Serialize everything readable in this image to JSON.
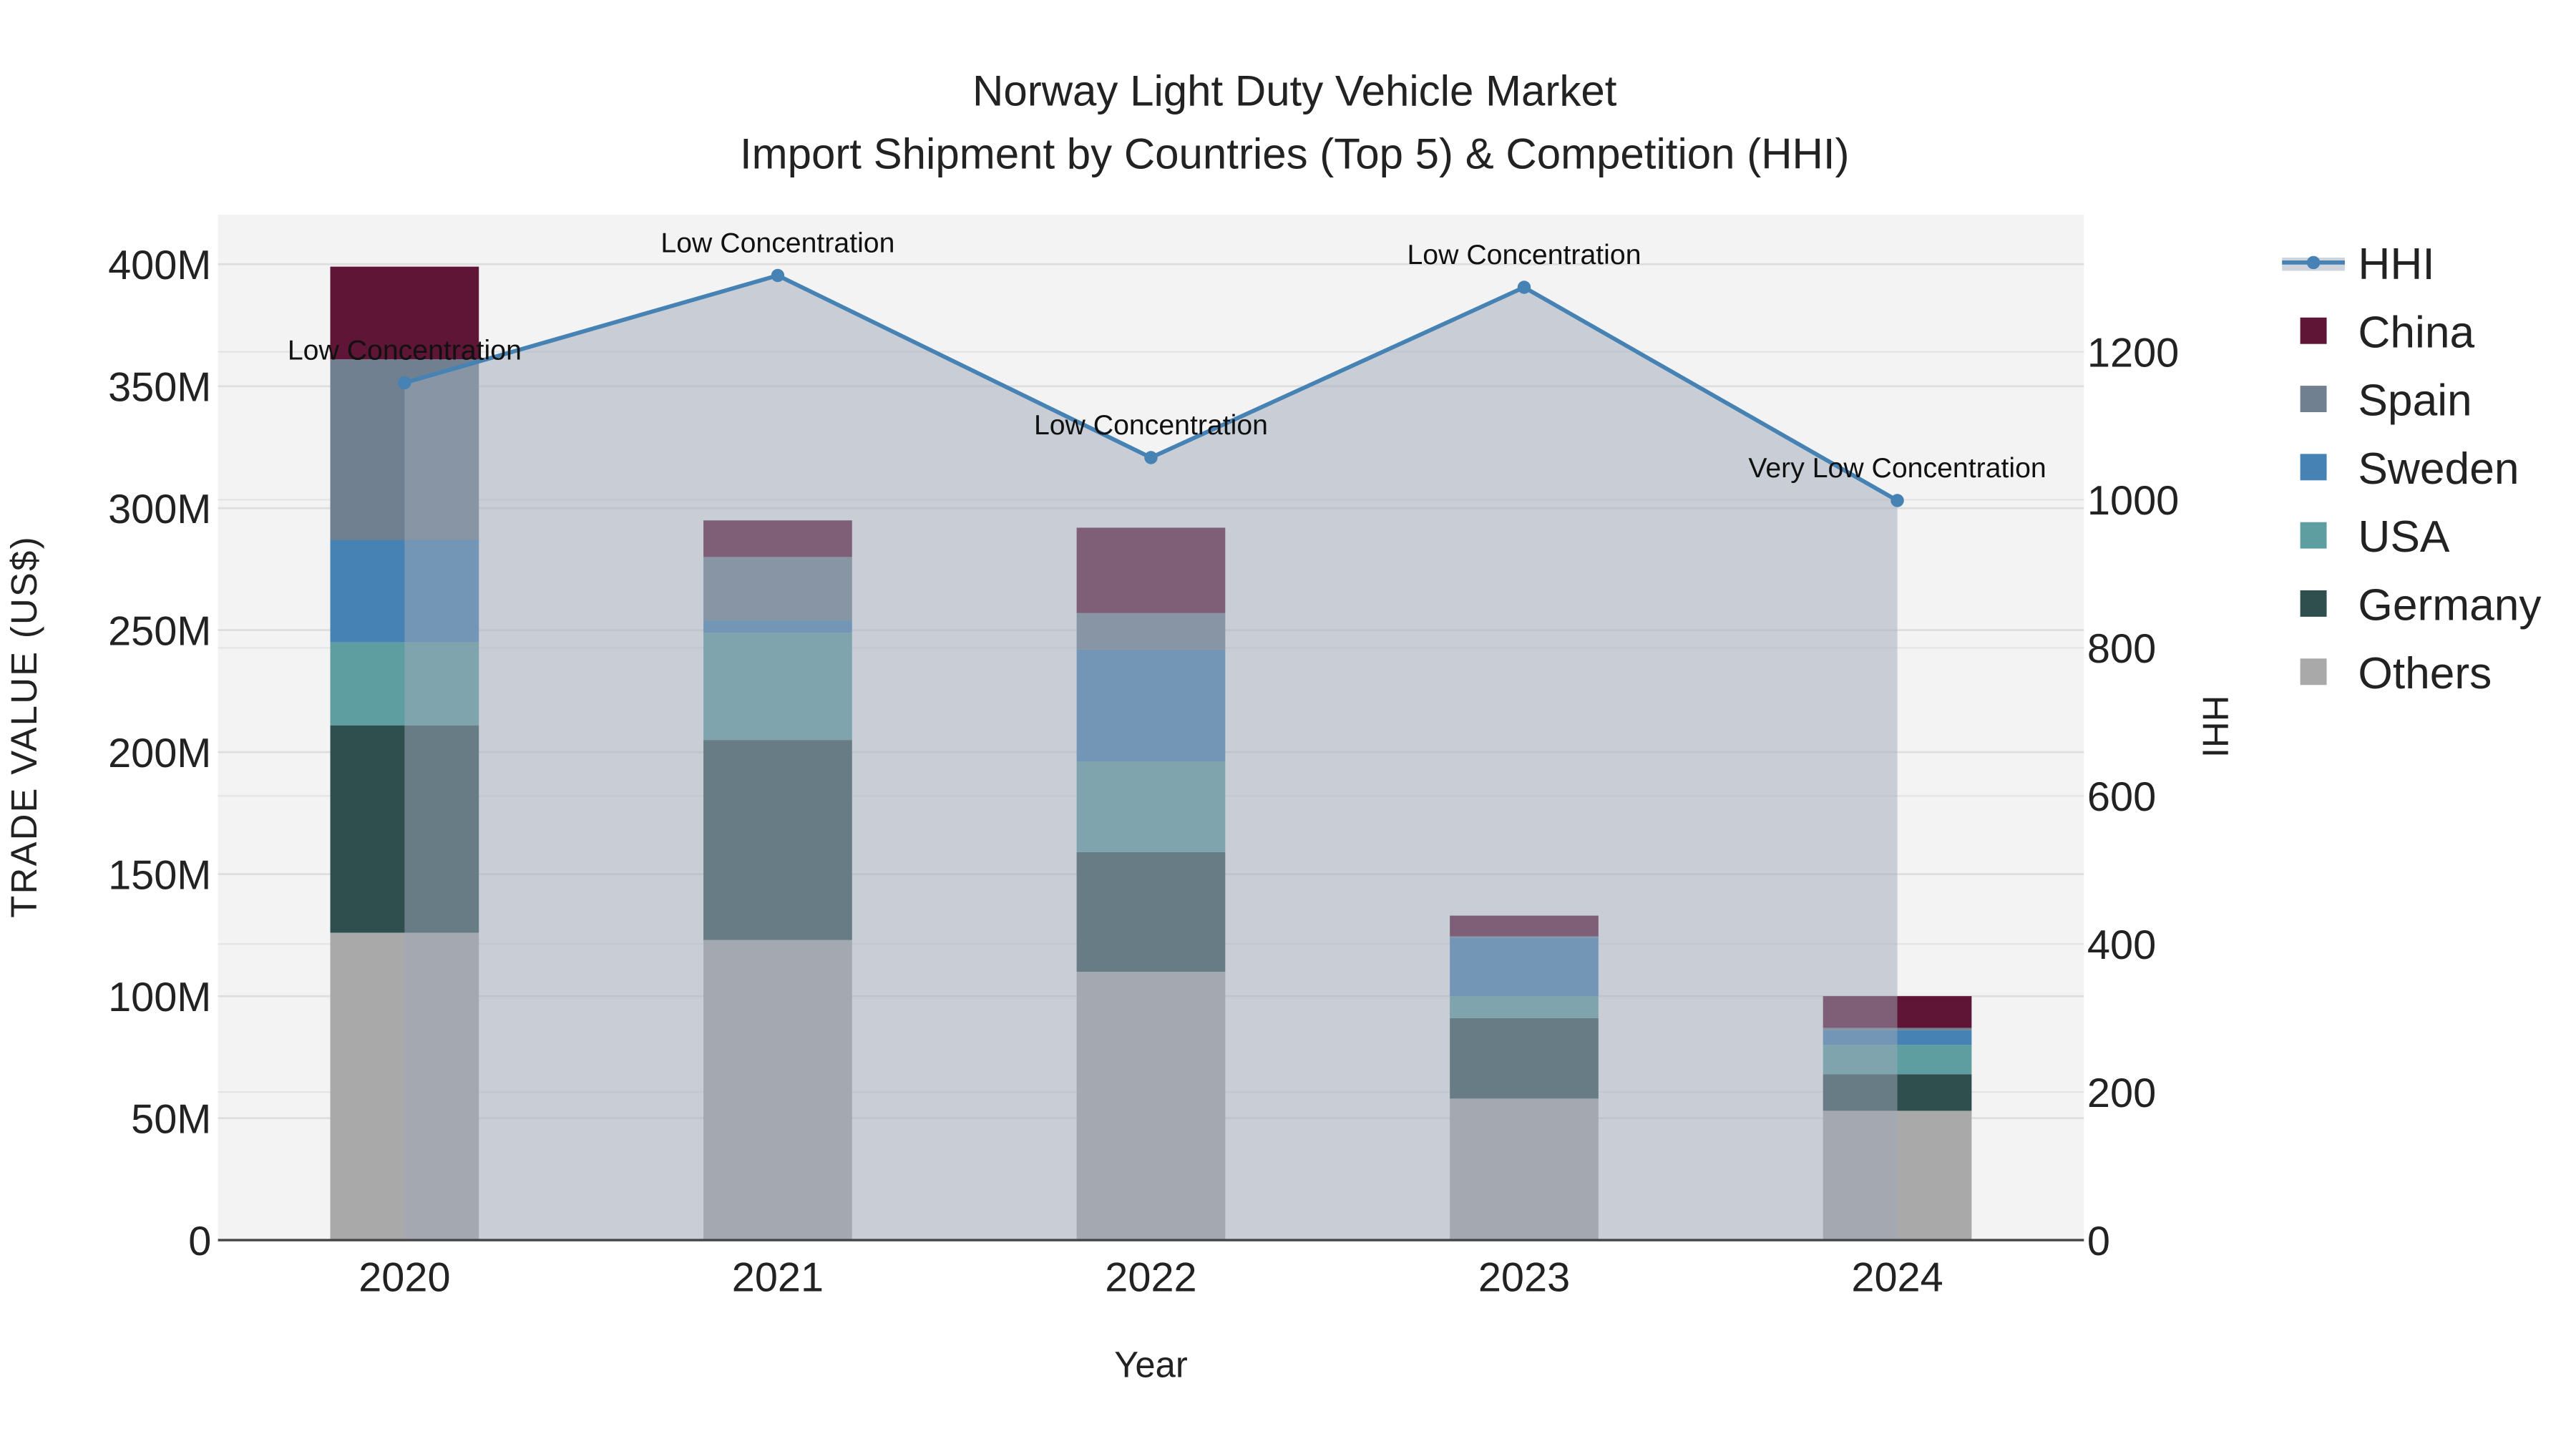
{
  "chart_data": {
    "type": "bar",
    "title": "Norway Light Duty Vehicle Market",
    "subtitle": "Import Shipment by Countries (Top 5) & Competition (HHI)",
    "xlabel": "Year",
    "ylabel": "TRADE VALUE (US$)",
    "y2label": "HHI",
    "categories": [
      "2020",
      "2021",
      "2022",
      "2023",
      "2024"
    ],
    "ylim": [
      0,
      420
    ],
    "yticks": [
      0,
      50,
      100,
      150,
      200,
      250,
      300,
      350,
      400
    ],
    "ytick_labels": [
      "0",
      "50M",
      "100M",
      "150M",
      "200M",
      "250M",
      "300M",
      "350M",
      "400M"
    ],
    "y2lim": [
      0,
      1385
    ],
    "y2ticks": [
      0,
      200,
      400,
      600,
      800,
      1000,
      1200
    ],
    "y2tick_labels": [
      "0",
      "200",
      "400",
      "600",
      "800",
      "1000",
      "1200"
    ],
    "units": "million US$",
    "series": [
      {
        "name": "Others",
        "color": "#a9a9a9",
        "values": [
          126,
          123,
          110,
          58,
          53
        ]
      },
      {
        "name": "Germany",
        "color": "#2f4f4f",
        "values": [
          85,
          82,
          49,
          33,
          15
        ]
      },
      {
        "name": "USA",
        "color": "#5f9ea0",
        "values": [
          34,
          44,
          37,
          9,
          12
        ]
      },
      {
        "name": "Sweden",
        "color": "#4682b4",
        "values": [
          42,
          5,
          46,
          24,
          6
        ]
      },
      {
        "name": "Spain",
        "color": "#708090",
        "values": [
          74,
          26,
          15,
          0.5,
          1
        ]
      },
      {
        "name": "China",
        "color": "#5f1535",
        "values": [
          38,
          15,
          35,
          8.5,
          13
        ]
      }
    ],
    "hhi": {
      "name": "HHI",
      "color": "#4682b4",
      "values": [
        1158,
        1303,
        1057,
        1287,
        999
      ],
      "annotations": [
        "Low Concentration",
        "Low Concentration",
        "Low Concentration",
        "Low Concentration",
        "Very Low Concentration"
      ]
    },
    "legend": [
      "HHI",
      "China",
      "Spain",
      "Sweden",
      "USA",
      "Germany",
      "Others"
    ],
    "legend_placement": "right",
    "grid": true
  }
}
